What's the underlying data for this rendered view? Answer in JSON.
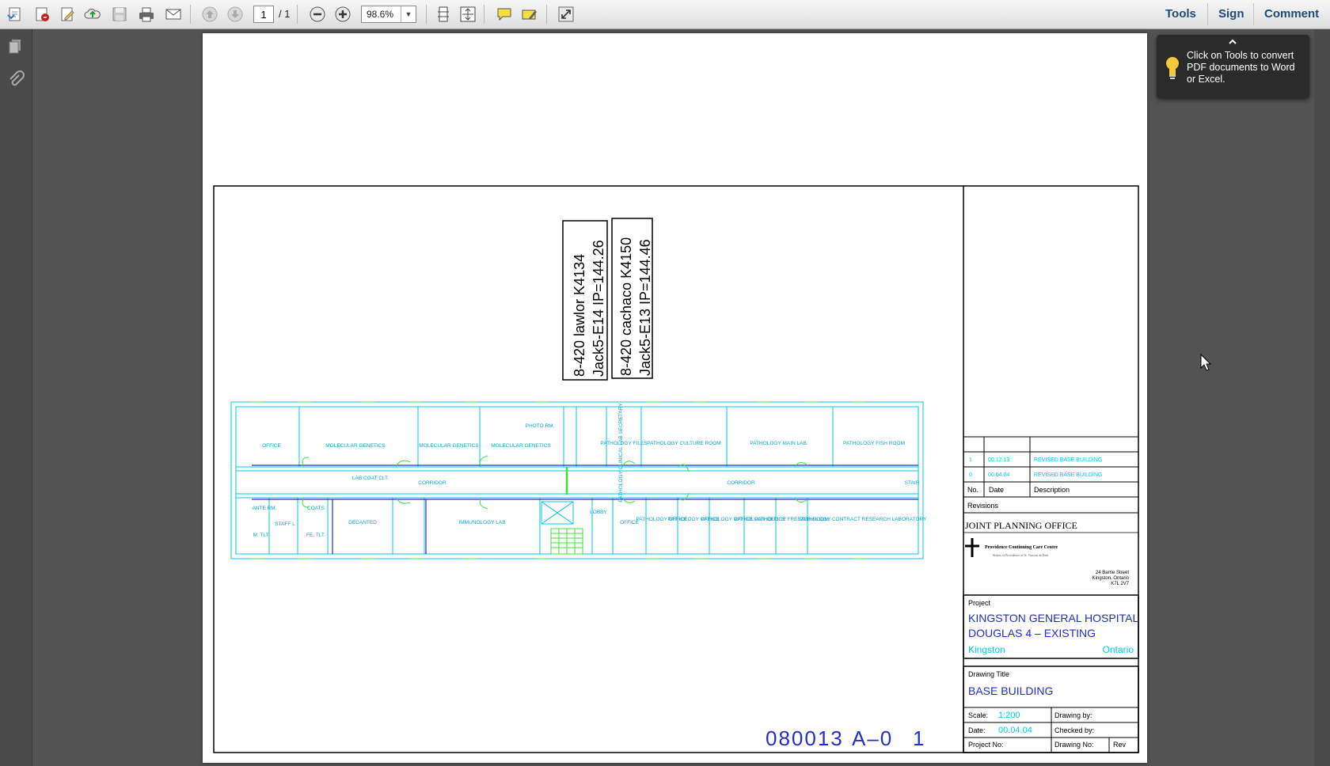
{
  "toolbar": {
    "page_current": "1",
    "page_total": "/ 1",
    "zoom": "98.6%",
    "tools_label": "Tools",
    "sign_label": "Sign",
    "comment_label": "Comment"
  },
  "tooltip": {
    "text": "Click on Tools to convert PDF documents to Word or Excel."
  },
  "drawing": {
    "label1_line1": "8-420 lawlor K4134",
    "label1_line2": "Jack5-E14 IP=144.26",
    "label2_line1": "8-420 cachaco K4150",
    "label2_line2": "Jack5-E13 IP=144.46",
    "rooms_top": [
      "OFFICE",
      "MOLECULAR GENETICS",
      "MOLECULAR GENETICS",
      "MOLECULAR GENETICS",
      "PHOTO RM.",
      "PATHOLOGY CLINICAL LAB SECRETARY",
      "PATHOLOGY FILES",
      "PATHOLOGY CULTURE ROOM",
      "PATHOLOGY MAIN LAB.",
      "PATHOLOGY FISH ROOM"
    ],
    "corridor_left": "CORRIDOR",
    "corridor_right": "CORRIDOR",
    "lab_coat": "LAB.COAT CLT.",
    "stair": "STAIR",
    "rooms_bottom": [
      "ANTE RM.",
      "STAFF L",
      "COATS",
      "M. TLT.",
      "FE. TLT.",
      "DECANTED",
      "IMMUNOLOGY LAB",
      "LOBBY",
      "OFFICE",
      "PATHOLOGY OFFICE",
      "PATHOLOGY OFFICE",
      "PATHOLOGY OFFICE",
      "PATHOLOGY OFFICE",
      "PATHOLOGY FREEZER ROOM",
      "PATHOLOGY CONTRACT RESEARCH LABORATORY"
    ]
  },
  "title_block": {
    "revisions": [
      {
        "no": "1",
        "date": "00.12.13",
        "desc": "REVISED BASE BUILDING"
      },
      {
        "no": "0",
        "date": "00.04.04",
        "desc": "REVISED BASE BUILDING"
      }
    ],
    "col_no": "No.",
    "col_date": "Date",
    "col_desc": "Description",
    "revisions_label": "Revisions",
    "office": "JOINT PLANNING OFFICE",
    "logo_name": "Providence Continuing Care Centre",
    "logo_sub": "Sisters of Providence of St. Vincent de Paul",
    "address1": "24 Barrie Street",
    "address2": "Kingston, Ontario",
    "address3": "K7L 2V7",
    "project_label": "Project",
    "project_line1": "KINGSTON GENERAL HOSPITAL",
    "project_line2": "DOUGLAS 4 – EXISTING",
    "city": "Kingston",
    "province": "Ontario",
    "drawing_title_label": "Drawing Title",
    "drawing_title": "BASE BUILDING",
    "scale_label": "Scale:",
    "scale": "1:200",
    "drawing_by_label": "Drawing by:",
    "date_label": "Date:",
    "date": "00.04.04",
    "checked_by_label": "Checked by:",
    "project_no_label": "Project No:",
    "project_no": "080013",
    "drawing_no_label": "Drawing No:",
    "drawing_no": "A–0",
    "rev_label": "Rev",
    "rev": "1"
  },
  "colors": {
    "cad_cyan": "#00c8e8",
    "cad_blue": "#2030c8",
    "cad_green": "#40e040",
    "accent": "#1e4a7a"
  }
}
